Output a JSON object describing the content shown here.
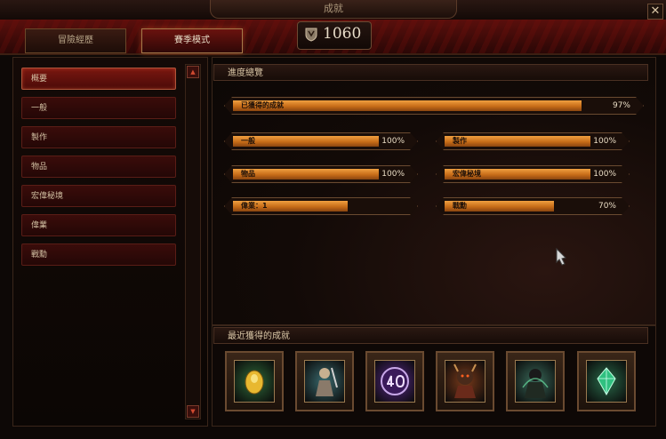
{
  "window": {
    "title": "成就",
    "close_glyph": "✕"
  },
  "tabs": [
    {
      "label": "冒險經歷",
      "active": false
    },
    {
      "label": "賽季模式",
      "active": true
    }
  ],
  "score": {
    "value": "1060"
  },
  "sidebar": {
    "items": [
      {
        "label": "概要",
        "active": true
      },
      {
        "label": "一般",
        "active": false
      },
      {
        "label": "製作",
        "active": false
      },
      {
        "label": "物品",
        "active": false
      },
      {
        "label": "宏偉秘境",
        "active": false
      },
      {
        "label": "偉業",
        "active": false
      },
      {
        "label": "戰勳",
        "active": false
      }
    ],
    "scroll_up": "▲",
    "scroll_down": "▼"
  },
  "progress": {
    "header": "進度總覽",
    "overall": {
      "label": "已獲得的成就",
      "percent_text": "97%",
      "fraction": 0.97
    },
    "categories": [
      {
        "label": "一般",
        "percent_text": "100%",
        "fraction": 1.0
      },
      {
        "label": "製作",
        "percent_text": "100%",
        "fraction": 1.0
      },
      {
        "label": "物品",
        "percent_text": "100%",
        "fraction": 1.0
      },
      {
        "label": "宏偉秘境",
        "percent_text": "100%",
        "fraction": 1.0
      },
      {
        "label": "偉業：1",
        "percent_text": "",
        "fraction": 0.65
      },
      {
        "label": "戰勳",
        "percent_text": "70%",
        "fraction": 0.7
      }
    ]
  },
  "recent": {
    "header": "最近獲得的成就",
    "icons": [
      {
        "icon": "golden-egg-icon",
        "color": "#2f6a3a"
      },
      {
        "icon": "warrior-icon",
        "color": "#3a6a6e"
      },
      {
        "icon": "forty-medallion-icon",
        "color": "#5a2a8a"
      },
      {
        "icon": "demon-lord-icon",
        "color": "#7a3a1a"
      },
      {
        "icon": "dark-figure-icon",
        "color": "#3a6a5a"
      },
      {
        "icon": "green-crystal-icon",
        "color": "#2a6a4a"
      }
    ]
  },
  "colors": {
    "accent": "#c76c18",
    "brand_red": "#6a120e"
  }
}
